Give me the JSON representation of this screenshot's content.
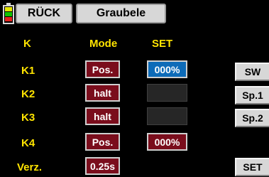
{
  "top": {
    "back": "RÜCK",
    "model_name": "Graubele"
  },
  "headers": {
    "channel": "K",
    "mode": "Mode",
    "set": "SET"
  },
  "rows": [
    {
      "label": "K1",
      "mode": "Pos.",
      "set": "000%"
    },
    {
      "label": "K2",
      "mode": "halt",
      "set": ""
    },
    {
      "label": "K3",
      "mode": "halt",
      "set": ""
    },
    {
      "label": "K4",
      "mode": "Pos.",
      "set": "000%"
    }
  ],
  "delay": {
    "label": "Verz.",
    "value": "0.25s"
  },
  "side_buttons": {
    "sw": "SW",
    "sp1": "Sp.1",
    "sp2": "Sp.2",
    "set": "SET"
  },
  "icons": {
    "battery": "battery-icon"
  },
  "colors": {
    "label_yellow": "#ffe400",
    "value_red": "#7a0d1c",
    "selected_blue": "#0d6bb8",
    "battery_green": "#12c400",
    "battery_yellow": "#e6e600",
    "battery_red": "#e8231e"
  }
}
